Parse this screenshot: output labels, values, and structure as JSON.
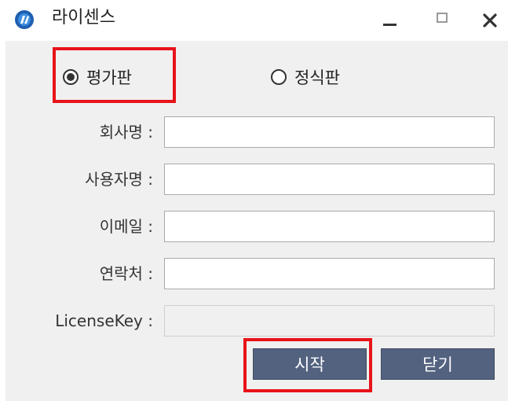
{
  "window": {
    "title": "라이센스",
    "minimize_glyph": "minimize-icon",
    "maximize_glyph": "maximize-icon",
    "close_glyph": "✕"
  },
  "license_type": {
    "options": [
      {
        "label": "평가판",
        "selected": true
      },
      {
        "label": "정식판",
        "selected": false
      }
    ]
  },
  "form": {
    "company_label": "회사명 :",
    "company_value": "",
    "user_label": "사용자명 :",
    "user_value": "",
    "email_label": "이메일 :",
    "email_value": "",
    "contact_label": "연락처 :",
    "contact_value": "",
    "license_key_label": "LicenseKey :",
    "license_key_value": ""
  },
  "buttons": {
    "start_label": "시작",
    "close_label": "닫기"
  },
  "colors": {
    "button_bg": "#53627f",
    "highlight": "#e8131a",
    "panel_bg": "#f0f0f0"
  }
}
